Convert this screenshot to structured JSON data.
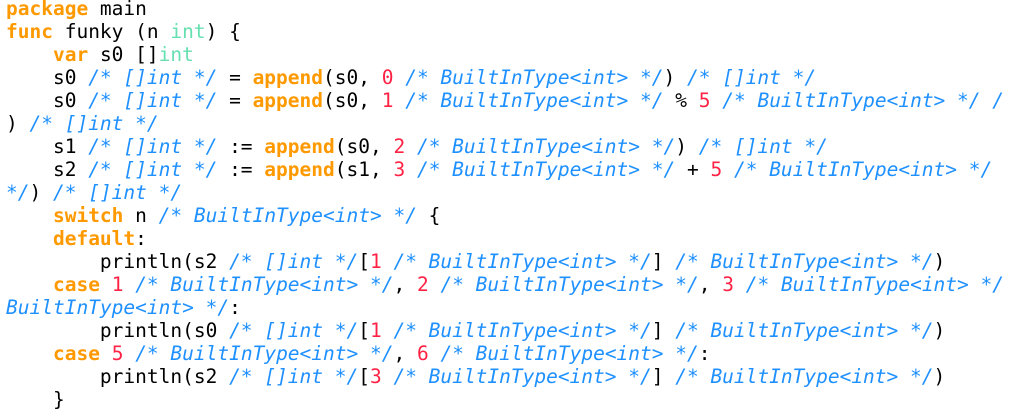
{
  "colors": {
    "background": "#ffffff",
    "plain": "#000000",
    "keyword": "#ff9900",
    "builtin_function": "#ff9900",
    "type": "#66e0b0",
    "number": "#ff2244",
    "comment": "#1e90ff"
  },
  "lines": [
    [
      {
        "t": "package",
        "k": "kw"
      },
      {
        "t": " main",
        "k": "pl"
      }
    ],
    [
      {
        "t": "func",
        "k": "kw"
      },
      {
        "t": " funky (n ",
        "k": "pl"
      },
      {
        "t": "int",
        "k": "ty"
      },
      {
        "t": ") {",
        "k": "pl"
      }
    ],
    [
      {
        "t": "    ",
        "k": "pl"
      },
      {
        "t": "var",
        "k": "kw"
      },
      {
        "t": " s0 []",
        "k": "pl"
      },
      {
        "t": "int",
        "k": "ty"
      }
    ],
    [
      {
        "t": "    s0 ",
        "k": "pl"
      },
      {
        "t": "/* []int */",
        "k": "cm"
      },
      {
        "t": " = ",
        "k": "pl"
      },
      {
        "t": "append",
        "k": "fn"
      },
      {
        "t": "(s0, ",
        "k": "pl"
      },
      {
        "t": "0",
        "k": "num"
      },
      {
        "t": " ",
        "k": "pl"
      },
      {
        "t": "/* BuiltInType<int> */",
        "k": "cm"
      },
      {
        "t": ") ",
        "k": "pl"
      },
      {
        "t": "/* []int */",
        "k": "cm"
      }
    ],
    [
      {
        "t": "    s0 ",
        "k": "pl"
      },
      {
        "t": "/* []int */",
        "k": "cm"
      },
      {
        "t": " = ",
        "k": "pl"
      },
      {
        "t": "append",
        "k": "fn"
      },
      {
        "t": "(s0, ",
        "k": "pl"
      },
      {
        "t": "1",
        "k": "num"
      },
      {
        "t": " ",
        "k": "pl"
      },
      {
        "t": "/* BuiltInType<int> */",
        "k": "cm"
      },
      {
        "t": " % ",
        "k": "pl"
      },
      {
        "t": "5",
        "k": "num"
      },
      {
        "t": " ",
        "k": "pl"
      },
      {
        "t": "/* BuiltInType<int> */ /",
        "k": "cm"
      }
    ],
    [
      {
        "t": ") ",
        "k": "pl"
      },
      {
        "t": "/* []int */",
        "k": "cm"
      }
    ],
    [
      {
        "t": "    s1 ",
        "k": "pl"
      },
      {
        "t": "/* []int */",
        "k": "cm"
      },
      {
        "t": " := ",
        "k": "pl"
      },
      {
        "t": "append",
        "k": "fn"
      },
      {
        "t": "(s0, ",
        "k": "pl"
      },
      {
        "t": "2",
        "k": "num"
      },
      {
        "t": " ",
        "k": "pl"
      },
      {
        "t": "/* BuiltInType<int> */",
        "k": "cm"
      },
      {
        "t": ") ",
        "k": "pl"
      },
      {
        "t": "/* []int */",
        "k": "cm"
      }
    ],
    [
      {
        "t": "    s2 ",
        "k": "pl"
      },
      {
        "t": "/* []int */",
        "k": "cm"
      },
      {
        "t": " := ",
        "k": "pl"
      },
      {
        "t": "append",
        "k": "fn"
      },
      {
        "t": "(s1, ",
        "k": "pl"
      },
      {
        "t": "3",
        "k": "num"
      },
      {
        "t": " ",
        "k": "pl"
      },
      {
        "t": "/* BuiltInType<int> */",
        "k": "cm"
      },
      {
        "t": " + ",
        "k": "pl"
      },
      {
        "t": "5",
        "k": "num"
      },
      {
        "t": " ",
        "k": "pl"
      },
      {
        "t": "/* BuiltInType<int> */",
        "k": "cm"
      }
    ],
    [
      {
        "t": "*/",
        "k": "cm"
      },
      {
        "t": ") ",
        "k": "pl"
      },
      {
        "t": "/* []int */",
        "k": "cm"
      }
    ],
    [
      {
        "t": "    ",
        "k": "pl"
      },
      {
        "t": "switch",
        "k": "kw"
      },
      {
        "t": " n ",
        "k": "pl"
      },
      {
        "t": "/* BuiltInType<int> */",
        "k": "cm"
      },
      {
        "t": " {",
        "k": "pl"
      }
    ],
    [
      {
        "t": "    ",
        "k": "pl"
      },
      {
        "t": "default",
        "k": "kw"
      },
      {
        "t": ":",
        "k": "pl"
      }
    ],
    [
      {
        "t": "        println(s2 ",
        "k": "pl"
      },
      {
        "t": "/* []int */",
        "k": "cm"
      },
      {
        "t": "[",
        "k": "pl"
      },
      {
        "t": "1",
        "k": "num"
      },
      {
        "t": " ",
        "k": "pl"
      },
      {
        "t": "/* BuiltInType<int> */",
        "k": "cm"
      },
      {
        "t": "] ",
        "k": "pl"
      },
      {
        "t": "/* BuiltInType<int> */",
        "k": "cm"
      },
      {
        "t": ")",
        "k": "pl"
      }
    ],
    [
      {
        "t": "    ",
        "k": "pl"
      },
      {
        "t": "case",
        "k": "kw"
      },
      {
        "t": " ",
        "k": "pl"
      },
      {
        "t": "1",
        "k": "num"
      },
      {
        "t": " ",
        "k": "pl"
      },
      {
        "t": "/* BuiltInType<int> */",
        "k": "cm"
      },
      {
        "t": ", ",
        "k": "pl"
      },
      {
        "t": "2",
        "k": "num"
      },
      {
        "t": " ",
        "k": "pl"
      },
      {
        "t": "/* BuiltInType<int> */",
        "k": "cm"
      },
      {
        "t": ", ",
        "k": "pl"
      },
      {
        "t": "3",
        "k": "num"
      },
      {
        "t": " ",
        "k": "pl"
      },
      {
        "t": "/* BuiltInType<int> */",
        "k": "cm"
      }
    ],
    [
      {
        "t": "BuiltInType<int> */",
        "k": "cm"
      },
      {
        "t": ":",
        "k": "pl"
      }
    ],
    [
      {
        "t": "        println(s0 ",
        "k": "pl"
      },
      {
        "t": "/* []int */",
        "k": "cm"
      },
      {
        "t": "[",
        "k": "pl"
      },
      {
        "t": "1",
        "k": "num"
      },
      {
        "t": " ",
        "k": "pl"
      },
      {
        "t": "/* BuiltInType<int> */",
        "k": "cm"
      },
      {
        "t": "] ",
        "k": "pl"
      },
      {
        "t": "/* BuiltInType<int> */",
        "k": "cm"
      },
      {
        "t": ")",
        "k": "pl"
      }
    ],
    [
      {
        "t": "    ",
        "k": "pl"
      },
      {
        "t": "case",
        "k": "kw"
      },
      {
        "t": " ",
        "k": "pl"
      },
      {
        "t": "5",
        "k": "num"
      },
      {
        "t": " ",
        "k": "pl"
      },
      {
        "t": "/* BuiltInType<int> */",
        "k": "cm"
      },
      {
        "t": ", ",
        "k": "pl"
      },
      {
        "t": "6",
        "k": "num"
      },
      {
        "t": " ",
        "k": "pl"
      },
      {
        "t": "/* BuiltInType<int> */",
        "k": "cm"
      },
      {
        "t": ":",
        "k": "pl"
      }
    ],
    [
      {
        "t": "        println(s2 ",
        "k": "pl"
      },
      {
        "t": "/* []int */",
        "k": "cm"
      },
      {
        "t": "[",
        "k": "pl"
      },
      {
        "t": "3",
        "k": "num"
      },
      {
        "t": " ",
        "k": "pl"
      },
      {
        "t": "/* BuiltInType<int> */",
        "k": "cm"
      },
      {
        "t": "] ",
        "k": "pl"
      },
      {
        "t": "/* BuiltInType<int> */",
        "k": "cm"
      },
      {
        "t": ")",
        "k": "pl"
      }
    ],
    [
      {
        "t": "    }",
        "k": "pl"
      }
    ]
  ]
}
